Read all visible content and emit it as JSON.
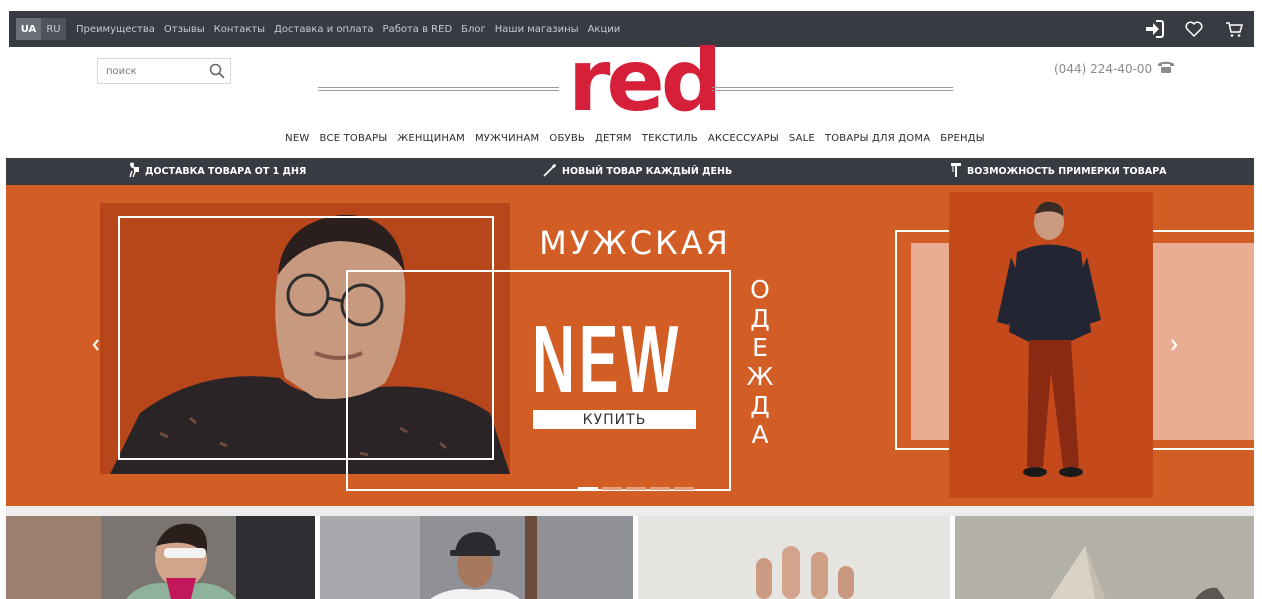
{
  "topbar": {
    "languages": [
      {
        "code": "UA",
        "active": true
      },
      {
        "code": "RU",
        "active": false
      }
    ],
    "nav": [
      "Преимущества",
      "Отзывы",
      "Контакты",
      "Доставка и оплата",
      "Работа в RED",
      "Блог",
      "Наши магазины",
      "Акции"
    ],
    "icons": [
      "login-icon",
      "heart-icon",
      "cart-icon"
    ]
  },
  "header": {
    "search_placeholder": "поиск",
    "logo": "red",
    "phone": "(044) 224-40-00"
  },
  "main_nav": [
    "NEW",
    "ВСЕ ТОВАРЫ",
    "ЖЕНЩИНАМ",
    "МУЖЧИНАМ",
    "ОБУВЬ",
    "ДЕТЯМ",
    "ТЕКСТИЛЬ",
    "АКСЕССУАРЫ",
    "SALE",
    "ТОВАРЫ ДЛЯ ДОМА",
    "БРЕНДЫ"
  ],
  "benefits": [
    {
      "text": "ДОСТАВКА ТОВАРА ОТ 1 ДНЯ",
      "icon": "delivery-person-icon"
    },
    {
      "text": "НОВЫЙ ТОВАР КАЖДЫЙ ДЕНЬ",
      "icon": "needle-icon"
    },
    {
      "text": "ВОЗМОЖНОСТЬ ПРИМЕРКИ ТОВАРА",
      "icon": "fitting-room-icon"
    }
  ],
  "hero": {
    "title": "МУЖСКАЯ",
    "big": "NEW",
    "vertical": [
      "О",
      "Д",
      "Е",
      "Ж",
      "Д",
      "А"
    ],
    "button": "КУПИТЬ",
    "slides_total": 5,
    "active_slide": 1
  },
  "colors": {
    "accent": "#d6203a",
    "dark_bar": "#393b42",
    "banner_orange": "#d25d25"
  }
}
